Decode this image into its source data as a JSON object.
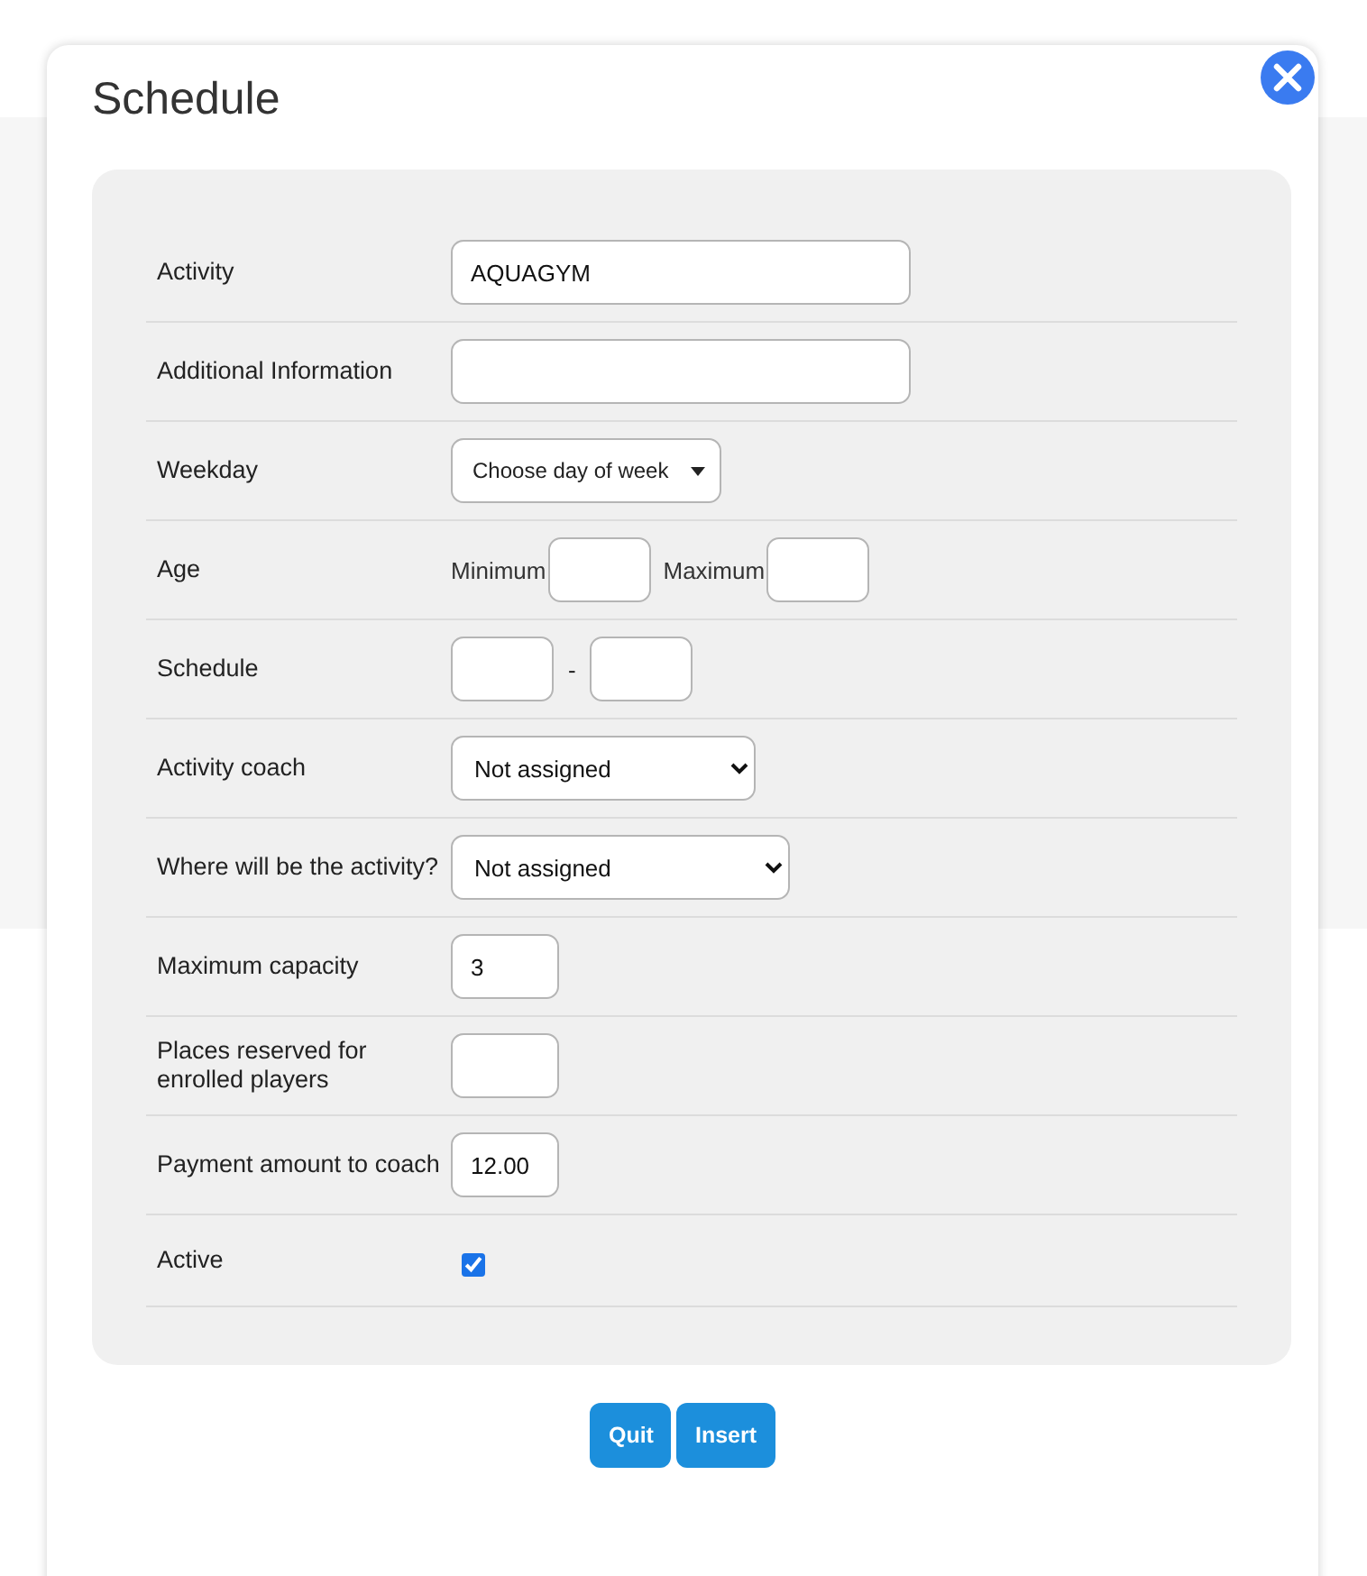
{
  "dialog": {
    "title": "Schedule"
  },
  "rows": [
    {
      "kind": "text",
      "label": "Activity",
      "value": "AQUAGYM"
    },
    {
      "kind": "text",
      "label": "Additional Information"
    },
    {
      "kind": "dropdown",
      "label": "Weekday",
      "value": "Choose day of week"
    },
    {
      "kind": "range",
      "label": "Age",
      "min_label": "Minimum",
      "max_label": "Maximum"
    },
    {
      "kind": "time-range",
      "label": "Schedule",
      "separator": "-"
    },
    {
      "kind": "select",
      "label": "Activity coach",
      "value": "Not assigned"
    },
    {
      "kind": "select",
      "label": "Where will be the activity?",
      "value": "Not assigned"
    },
    {
      "kind": "number",
      "label": "Maximum capacity",
      "value": "3"
    },
    {
      "kind": "number",
      "label": "Places reserved for enrolled players"
    },
    {
      "kind": "number",
      "label": "Payment amount to coach",
      "value": "12.00"
    },
    {
      "kind": "checkbox",
      "label": "Active",
      "checked": true
    }
  ],
  "buttons": [
    "Quit",
    "Insert"
  ]
}
